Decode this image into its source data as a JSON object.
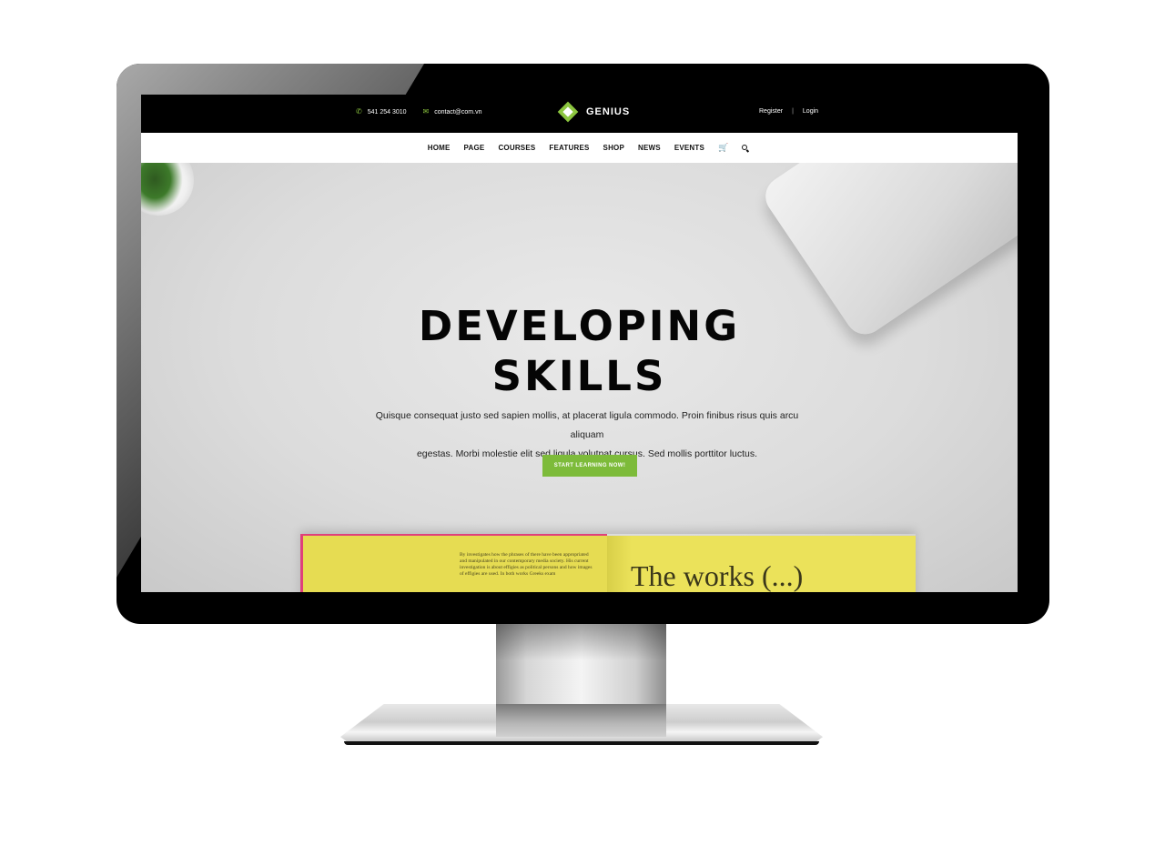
{
  "topbar": {
    "phone": "541 254 3010",
    "email": "contact@com.vn",
    "brand": "GENIUS",
    "register": "Register",
    "separator": "|",
    "login": "Login"
  },
  "nav": {
    "items": [
      "HOME",
      "PAGE",
      "COURSES",
      "FEATURES",
      "SHOP",
      "NEWS",
      "EVENTS"
    ]
  },
  "hero": {
    "title_line1": "DEVELOPING",
    "title_line2": "SKILLS",
    "subtitle_line1": "Quisque consequat justo sed sapien mollis, at placerat ligula commodo. Proin finibus risus quis arcu aliquam",
    "subtitle_line2": "egestas. Morbi molestie elit sed ligula volutpat cursus. Sed mollis porttitor luctus.",
    "cta": "START LEARNING NOW!",
    "book_title": "The works (...)",
    "book_text": "By investigates how the phrases of there have been appropriated and manipulated in our contemporary media society. His current investigation is about effigies as political persons and how images of effigies are used. In both works Greeks exam"
  },
  "colors": {
    "accent": "#8cc63f",
    "topbar_bg": "#000000",
    "nav_bg": "#ffffff",
    "cta_bg": "#7dbb3a"
  },
  "icons": {
    "phone": "phone-icon",
    "email": "envelope-icon",
    "cart": "cart-icon",
    "search": "search-icon",
    "logo": "diamond-logo-icon"
  }
}
